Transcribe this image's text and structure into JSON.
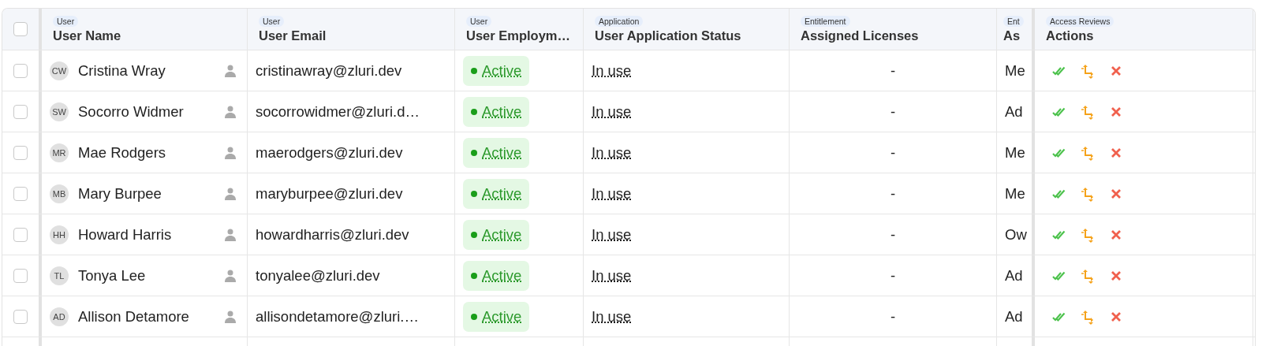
{
  "header_checkbox": {
    "checked": false
  },
  "columns": [
    {
      "category": "User",
      "title": "User Name"
    },
    {
      "category": "User",
      "title": "User Email"
    },
    {
      "category": "User",
      "title": "User Employm…"
    },
    {
      "category": "Application",
      "title": "User Application Status"
    },
    {
      "category": "Entitlement",
      "title": "Assigned Licenses"
    },
    {
      "category": "Ent",
      "title": "As"
    },
    {
      "category": "Access Reviews",
      "title": "Actions"
    }
  ],
  "rows": [
    {
      "checked": false,
      "initials": "CW",
      "name": "Cristina Wray",
      "email": "cristinawray@zluri.dev",
      "employment_status": "Active",
      "app_status": "In use",
      "licenses": "-",
      "column_7": "Me"
    },
    {
      "checked": false,
      "initials": "SW",
      "name": "Socorro Widmer",
      "email": "socorrowidmer@zluri.d…",
      "employment_status": "Active",
      "app_status": "In use",
      "licenses": "-",
      "column_7": "Ad"
    },
    {
      "checked": false,
      "initials": "MR",
      "name": "Mae Rodgers",
      "email": "maerodgers@zluri.dev",
      "employment_status": "Active",
      "app_status": "In use",
      "licenses": "-",
      "column_7": "Me"
    },
    {
      "checked": false,
      "initials": "MB",
      "name": "Mary Burpee",
      "email": "maryburpee@zluri.dev",
      "employment_status": "Active",
      "app_status": "In use",
      "licenses": "-",
      "column_7": "Me"
    },
    {
      "checked": false,
      "initials": "HH",
      "name": "Howard Harris",
      "email": "howardharris@zluri.dev",
      "employment_status": "Active",
      "app_status": "In use",
      "licenses": "-",
      "column_7": "Ow"
    },
    {
      "checked": false,
      "initials": "TL",
      "name": "Tonya Lee",
      "email": "tonyalee@zluri.dev",
      "employment_status": "Active",
      "app_status": "In use",
      "licenses": "-",
      "column_7": "Ad"
    },
    {
      "checked": false,
      "initials": "AD",
      "name": "Allison Detamore",
      "email": "allisondetamore@zluri.…",
      "employment_status": "Active",
      "app_status": "In use",
      "licenses": "-",
      "column_7": "Ad"
    }
  ]
}
